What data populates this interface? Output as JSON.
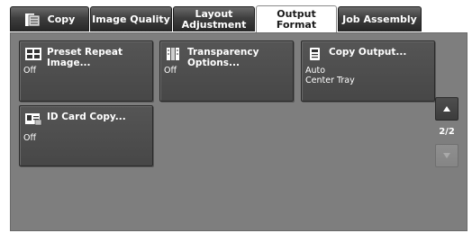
{
  "tabs": [
    {
      "label": "Copy",
      "icon": "copy-icon"
    },
    {
      "label": "Image Quality"
    },
    {
      "label": "Layout\nAdjustment"
    },
    {
      "label": "Output Format",
      "active": true
    },
    {
      "label": "Job Assembly"
    }
  ],
  "buttons": {
    "preset_repeat": {
      "title": "Preset Repeat Image...",
      "value": "Off"
    },
    "transparency": {
      "title": "Transparency\nOptions...",
      "value": "Off"
    },
    "copy_output": {
      "title": "Copy Output...",
      "value": "Auto\nCenter Tray"
    },
    "id_card": {
      "title": "ID Card Copy...",
      "value": "Off"
    }
  },
  "pager": {
    "indicator": "2/2"
  },
  "colors": {
    "panel": "#7e7e7e",
    "button": "#4d4d4d",
    "tab_dark": "#333333",
    "tab_active": "#ffffff"
  }
}
